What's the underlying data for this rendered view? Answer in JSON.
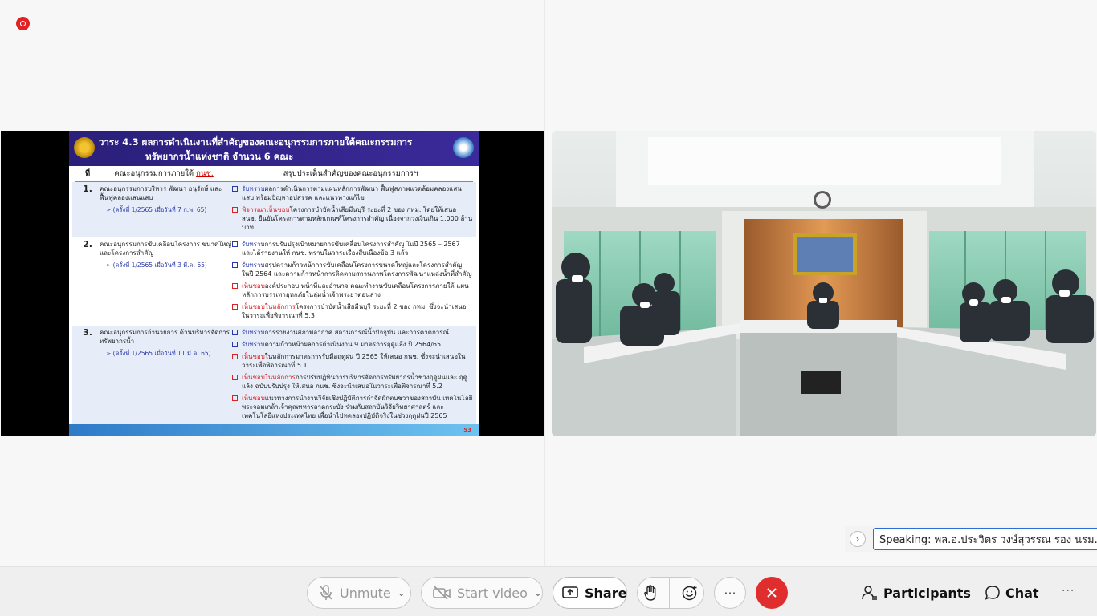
{
  "slide": {
    "title_line1": "วาระ 4.3   ผลการดำเนินงานที่สำคัญของคณะอนุกรรมการภายใต้คณะกรรมการ",
    "title_line2": "ทรัพยากรน้ำแห่งชาติ จำนวน 6 คณะ",
    "col_no": "ที่",
    "col_committee": "คณะอนุกรรมการภายใต้",
    "col_committee_abbr": "กนช.",
    "col_summary": "สรุปประเด็นสำคัญของคณะอนุกรรมการฯ",
    "rows": [
      {
        "num": "1.",
        "name": "คณะอนุกรรมการบริหาร พัฒนา อนุรักษ์ และฟื้นฟูคลองแสนแสบ",
        "meeting": "➢  (ครั้งที่ 1/2565 เมื่อวันที่ 7 ก.พ. 65)",
        "items": [
          {
            "hl": "รับทราบ",
            "text": "ผลการดำเนินการตามแผนหลักการพัฒนา ฟื้นฟูสภาพแวดล้อมคลองแสนแสบ พร้อมปัญหาอุปสรรค และแนวทางแก้ไข"
          },
          {
            "hl": "พิจารณาเห็นชอบ",
            "text": "โครงการบำบัดน้ำเสียมีนบุรี ระยะที่ 2 ของ กทม. โดยให้เสนอ สนช. ยืนยันโครงการตามหลักเกณฑ์โครงการสำคัญ เนื่องจากวงเงินเกิน 1,000 ล้านบาท"
          }
        ]
      },
      {
        "num": "2.",
        "name": "คณะอนุกรรมการขับเคลื่อนโครงการ ขนาดใหญ่และโครงการสำคัญ",
        "meeting": "➢  (ครั้งที่ 1/2565 เมื่อวันที่ 3 มี.ค. 65)",
        "items": [
          {
            "hl": "รับทราบ",
            "text": "การปรับปรุงเป้าหมายการขับเคลื่อนโครงการสำคัญ ในปี 2565 – 2567 และได้รายงานให้ กนช. ทราบในวาระเรื่องสืบเนื่องข้อ 3 แล้ว"
          },
          {
            "hl": "รับทราบ",
            "text": "สรุปความก้าวหน้าการขับเคลื่อนโครงการขนาดใหญ่และโครงการสำคัญ ในปี 2564 และความก้าวหน้าการติดตามสถานภาพโครงการพัฒนาแหล่งน้ำที่สำคัญ"
          },
          {
            "hl": "เห็นชอบ",
            "text": "องค์ประกอบ หน้าที่และอำนาจ คณะทำงานขับเคลื่อนโครงการภายใต้ แผนหลักการบรรเทาอุทกภัยในลุ่มน้ำเจ้าพระยาตอนล่าง"
          },
          {
            "hl": "เห็นชอบในหลักการ",
            "text": "โครงการบำบัดน้ำเสียมีนบุรี ระยะที่ 2 ของ กทม. ซึ่งจะนำเสนอในวาระเพื่อพิจารณาที่ 5.3"
          }
        ]
      },
      {
        "num": "3.",
        "name": "คณะอนุกรรมการอำนวยการ ด้านบริหารจัดการทรัพยากรน้ำ",
        "meeting": "➢ (ครั้งที่ 1/2565 เมื่อวันที่ 11 มี.ค. 65)",
        "items": [
          {
            "hl": "รับทราบ",
            "text": "การรายงานสภาพอากาศ สถานการณ์น้ำปัจจุบัน และการคาดการณ์"
          },
          {
            "hl": "รับทราบ",
            "text": "ความก้าวหน้าผลการดำเนินงาน 9 มาตรการฤดูแล้ง ปี 2564/65"
          },
          {
            "hl": "เห็นชอบ",
            "text": "ในหลักการมาตรการรับมือฤดูฝน ปี 2565 ให้เสนอ กนช. ซึ่งจะนำเสนอในวาระเพื่อพิจารณาที่ 5.1"
          },
          {
            "hl": "เห็นชอบในหลักการ",
            "text": "การปรับปฏิทินการบริหารจัดการทรัพยากรน้ำช่วงฤดูฝนและ ฤดูแล้ง ฉบับปรับปรุง ให้เสนอ กนช. ซึ่งจะนำเสนอในวาระเพื่อพิจารณาที่ 5.2"
          },
          {
            "hl": "เห็นชอบ",
            "text": "แนวทางการนำงานวิจัยเชิงปฏิบัติการกำจัดผักตบชวาของสถาบัน เทคโนโลยีพระจอมเกล้าเจ้าคุณทหารลาดกระบัง ร่วมกับสถาบันวิจัยวิทยาศาสตร์ และเทคโนโลยีแห่งประเทศไทย เพื่อนำไปทดลองปฏิบัติจริงในช่วงฤดูฝนปี 2565"
          }
        ]
      }
    ],
    "page": "53"
  },
  "speaking": {
    "text": "Speaking: พล.อ.ประวิตร วงษ์สุวรรณ รอง นรม.",
    "chevron": "›"
  },
  "controls": {
    "unmute_label": "Unmute",
    "video_label": "Start video",
    "share_label": "Share",
    "more_label": "···",
    "participants_label": "Participants",
    "chat_label": "Chat",
    "overflow_label": "···"
  },
  "icons": {
    "mic": "mic-off-icon",
    "video": "video-off-icon",
    "share": "share-screen-icon",
    "raise_hand": "raise-hand-icon",
    "reactions": "emoji-icon",
    "end": "end-call-icon",
    "participants": "participants-icon",
    "chat": "chat-icon"
  },
  "colors": {
    "accent": "#2a6fd6",
    "end_call": "#e02d2d",
    "recording": "#e02424"
  }
}
